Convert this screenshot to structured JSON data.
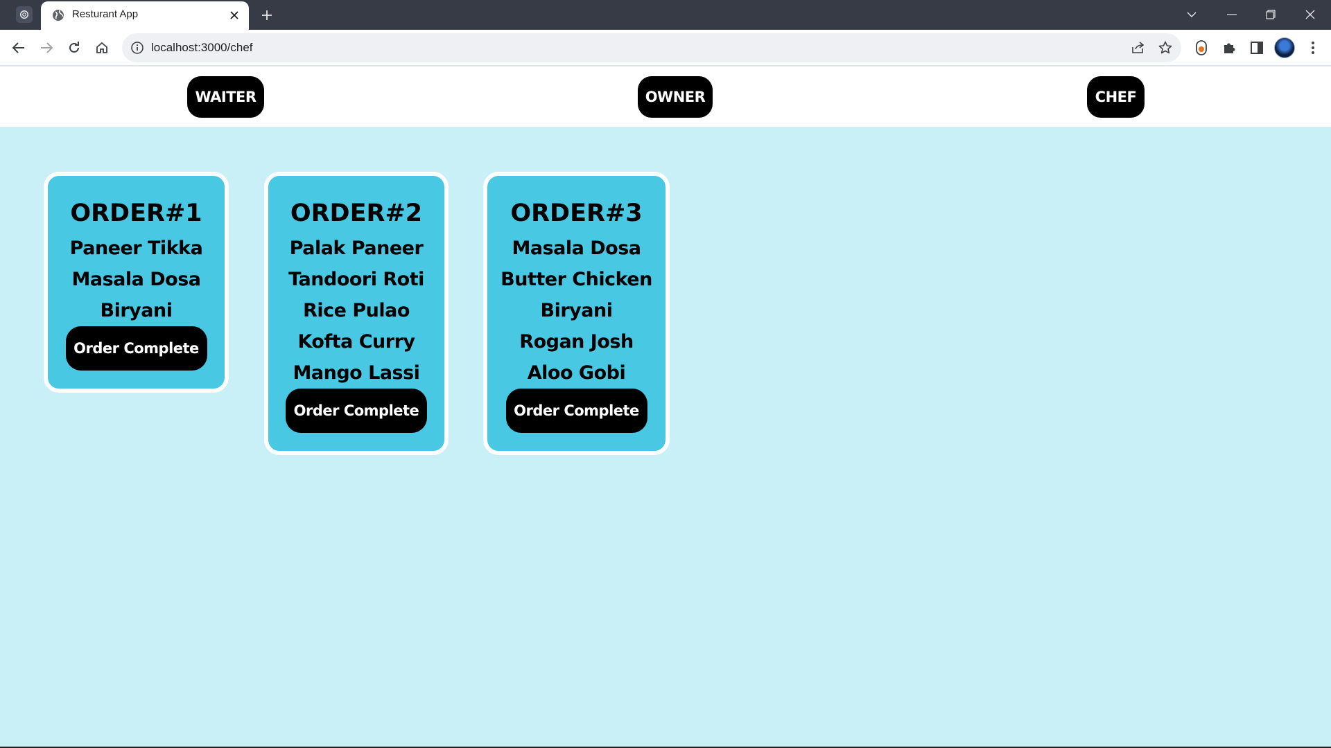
{
  "browser": {
    "tab_title": "Resturant App",
    "url": "localhost:3000/chef"
  },
  "header": {
    "roles": [
      {
        "label": "WAITER"
      },
      {
        "label": "OWNER"
      },
      {
        "label": "CHEF"
      }
    ]
  },
  "orders": [
    {
      "title": "ORDER#1",
      "items": [
        "Paneer Tikka",
        "Masala Dosa",
        "Biryani"
      ],
      "button_label": "Order Complete"
    },
    {
      "title": "ORDER#2",
      "items": [
        "Palak Paneer",
        "Tandoori Roti",
        "Rice Pulao",
        "Kofta Curry",
        "Mango Lassi"
      ],
      "button_label": "Order Complete"
    },
    {
      "title": "ORDER#3",
      "items": [
        "Masala Dosa",
        "Butter Chicken",
        "Biryani",
        "Rogan Josh",
        "Aloo Gobi"
      ],
      "button_label": "Order Complete"
    }
  ],
  "colors": {
    "page_background": "#c9f0f7",
    "card_background": "#48c8e3",
    "button_background": "#000000",
    "titlebar": "#363b45"
  },
  "icons": {
    "app": "chatgpt-icon",
    "tab": "globe-icon",
    "nav": [
      "back-icon",
      "forward-icon",
      "reload-icon",
      "home-icon"
    ],
    "omnibox": [
      "info-icon",
      "share-icon",
      "star-icon"
    ],
    "toolbar": [
      "extension-badge-icon",
      "puzzle-icon",
      "sidebar-icon",
      "avatar",
      "menu-dots-icon"
    ]
  }
}
